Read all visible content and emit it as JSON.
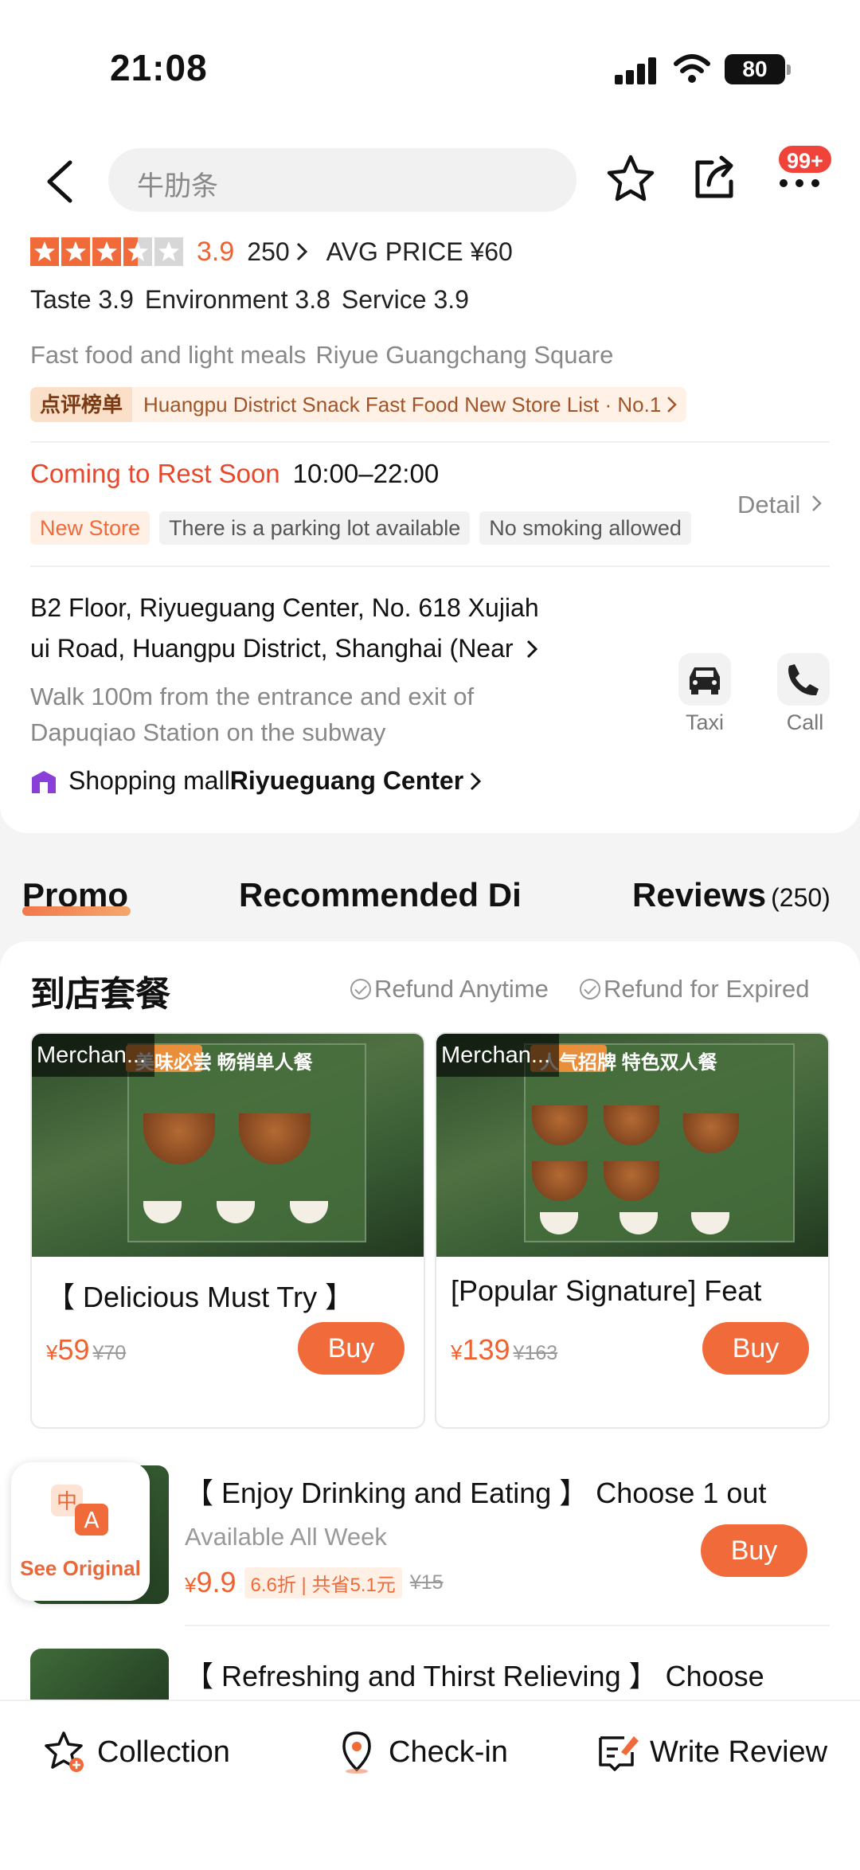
{
  "status_bar": {
    "time": "21:08",
    "battery": "80"
  },
  "nav": {
    "search_placeholder": "牛肋条",
    "more_badge": "99+"
  },
  "rating": {
    "stars_filled": 3.5,
    "stars_total": 5,
    "score": "3.9",
    "review_count": "250",
    "avg_price": "AVG PRICE ¥60"
  },
  "sub_scores": [
    "Taste 3.9",
    "Environment 3.8",
    "Service 3.9"
  ],
  "categories": [
    "Fast food and light meals",
    "Riyue Guangchang Square"
  ],
  "ranking": {
    "badge": "点评榜单",
    "text": "Huangpu District Snack Fast Food New Store List · No.1"
  },
  "hours": {
    "status": "Coming to Rest Soon",
    "time": "10:00–22:00"
  },
  "tags": [
    "New Store",
    "There is a parking lot available",
    "No smoking allowed"
  ],
  "detail_label": "Detail",
  "address": {
    "line1": "B2 Floor, Riyueguang Center, No. 618 Xujiah",
    "line2": "ui Road, Huangpu District, Shanghai (Near",
    "walk": "Walk 100m from the entrance and exit of Dapuqiao Station on the subway",
    "mall_prefix": "Shopping mall",
    "mall_name": "Riyueguang Center"
  },
  "actions": {
    "taxi": "Taxi",
    "call": "Call"
  },
  "tabs": {
    "promo": "Promo",
    "recommended": "Recommended Di",
    "reviews": "Reviews",
    "reviews_count": "(250)"
  },
  "promo": {
    "title": "到店套餐",
    "refund_anytime": "Refund Anytime",
    "refund_expired": "Refund for Expired",
    "deals": [
      {
        "merchant": "Merchan...",
        "headline": "美味必尝 畅销单人餐",
        "title": "【 Delicious Must Try 】",
        "price": "59",
        "old_price": "¥70",
        "buy": "Buy"
      },
      {
        "merchant": "Merchan...",
        "headline": "人气招牌 特色双人餐",
        "title": "[Popular Signature] Feat",
        "price": "139",
        "old_price": "¥163",
        "buy": "Buy"
      }
    ],
    "items": [
      {
        "title": "【 Enjoy Drinking and Eating 】 Choose 1 out",
        "sub": "Available All Week",
        "price": "9.9",
        "discount": "6.6折 | 共省5.1元",
        "old_price": "¥15",
        "buy": "Buy"
      },
      {
        "title": "【 Refreshing and Thirst Relieving 】 Choose"
      }
    ]
  },
  "see_original": "See Original",
  "bottom": {
    "collection": "Collection",
    "checkin": "Check-in",
    "review": "Write Review"
  },
  "colors": {
    "accent": "#f06a3a",
    "closed": "#e8472c",
    "badge": "#f0433a"
  }
}
